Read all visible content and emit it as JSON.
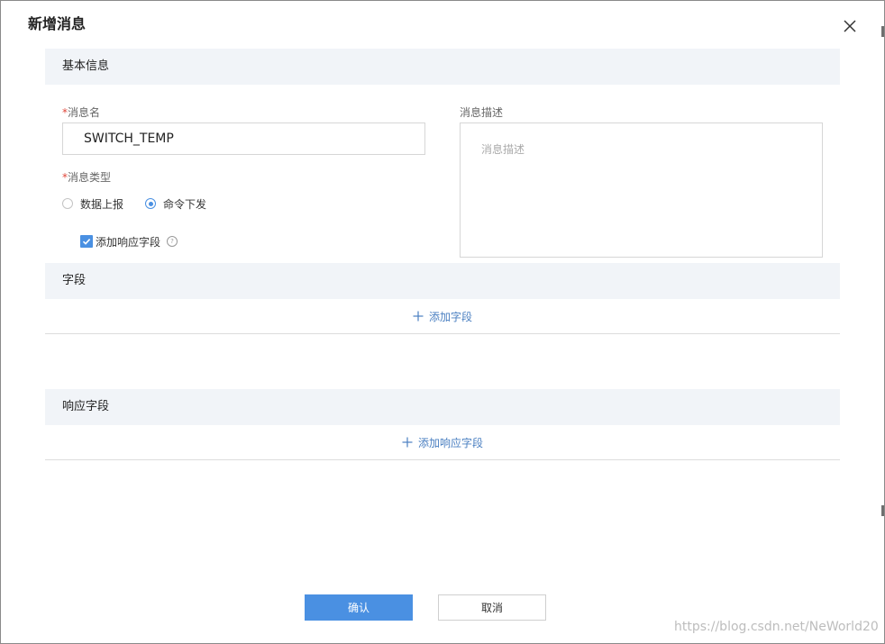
{
  "dialog": {
    "title": "新增消息"
  },
  "basic_info": {
    "section_title": "基本信息",
    "message_name": {
      "required_mark": "*",
      "label": "消息名",
      "value": "SWITCH_TEMP"
    },
    "message_description": {
      "label": "消息描述",
      "placeholder": "消息描述"
    },
    "message_type": {
      "required_mark": "*",
      "label": "消息类型",
      "options": [
        {
          "label": "数据上报",
          "selected": false
        },
        {
          "label": "命令下发",
          "selected": true
        }
      ]
    },
    "add_response_checkbox": {
      "label": "添加响应字段",
      "checked": true,
      "help_glyph": "?"
    }
  },
  "fields": {
    "section_title": "字段",
    "add_label": "添加字段"
  },
  "response_fields": {
    "section_title": "响应字段",
    "add_label": "添加响应字段"
  },
  "footer": {
    "confirm_label": "确认",
    "cancel_label": "取消"
  },
  "watermark": "https://blog.csdn.net/NeWorld20",
  "colors": {
    "accent": "#4a90e2",
    "link": "#4a7fc1",
    "required": "#e0473b",
    "section_bg": "#f1f4f8"
  }
}
